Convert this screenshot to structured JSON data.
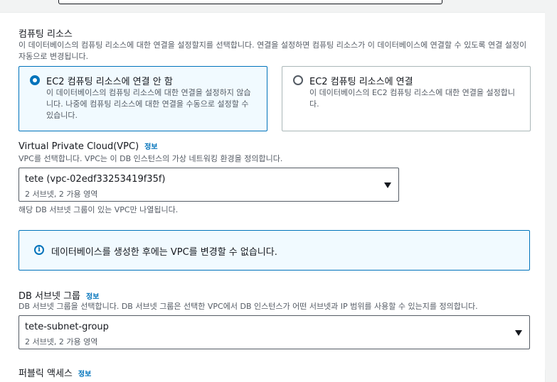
{
  "compute": {
    "heading": "컴퓨팅 리소스",
    "description": "이 데이터베이스의 컴퓨팅 리소스에 대한 연결을 설정할지를 선택합니다. 연결을 설정하면 컴퓨팅 리소스가 이 데이터베이스에 연결할 수 있도록 연결 설정이 자동으로 변경됩니다.",
    "options": [
      {
        "title": "EC2 컴퓨팅 리소스에 연결 안 함",
        "description": "이 데이터베이스의 컴퓨팅 리소스에 대한 연결을 설정하지 않습니다. 나중에 컴퓨팅 리소스에 대한 연결을 수동으로 설정할 수 있습니다.",
        "selected": true
      },
      {
        "title": "EC2 컴퓨팅 리소스에 연결",
        "description": "이 데이터베이스의 EC2 컴퓨팅 리소스에 대한 연결을 설정합니다.",
        "selected": false
      }
    ]
  },
  "vpc": {
    "label": "Virtual Private Cloud(VPC)",
    "info": "정보",
    "description": "VPC를 선택합니다. VPC는 이 DB 인스턴스의 가상 네트워킹 환경을 정의합니다.",
    "selected_value": "tete (vpc-02edf33253419f35f)",
    "selected_sub": "2 서브넷, 2 가용 영역",
    "hint": "해당 DB 서브넷 그룹이 있는 VPC만 나열됩니다.",
    "alert": "데이터베이스를 생성한 후에는 VPC를 변경할 수 없습니다."
  },
  "subnet": {
    "label": "DB 서브넷 그룹",
    "info": "정보",
    "description": "DB 서브넷 그룹을 선택합니다. DB 서브넷 그룹은 선택한 VPC에서 DB 인스턴스가 어떤 서브넷과 IP 범위를 사용할 수 있는지를 정의합니다.",
    "selected_value": "tete-subnet-group",
    "selected_sub": "2 서브넷, 2 가용 영역"
  },
  "public_access": {
    "label": "퍼블릭 액세스",
    "info": "정보"
  },
  "colors": {
    "accent": "#0073bb",
    "selected_bg": "#f1faff",
    "text": "#16191f",
    "muted": "#545b64"
  }
}
